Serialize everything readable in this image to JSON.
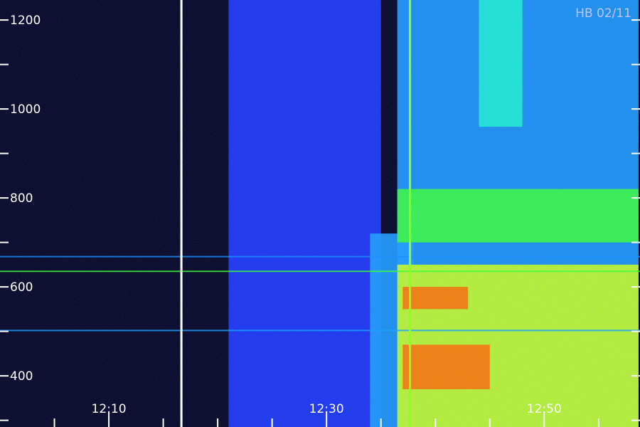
{
  "chart_data": {
    "type": "heatmap",
    "title": "",
    "corner_label": "HB 02/11",
    "xlabel": "",
    "ylabel": "",
    "x_range_minutes": [
      12.0,
      12.98
    ],
    "y_range": [
      285,
      1245
    ],
    "y_major_ticks": [
      {
        "value": 1200,
        "label": "1200"
      },
      {
        "value": 1000,
        "label": "1000"
      },
      {
        "value": 800,
        "label": "800"
      },
      {
        "value": 600,
        "label": "600"
      },
      {
        "value": 400,
        "label": "400"
      }
    ],
    "y_minor_ticks": [
      300,
      500,
      700,
      900,
      1100
    ],
    "x_major_ticks": [
      {
        "value": "12:10",
        "label": "12:10"
      },
      {
        "value": "12:30",
        "label": "12:30"
      },
      {
        "value": "12:50",
        "label": "12:50"
      }
    ],
    "x_minor_ticks": [
      "12:05",
      "12:15",
      "12:20",
      "12:25",
      "12:35",
      "12:40",
      "12:45",
      "12:55"
    ],
    "colormap": [
      "#05051e",
      "#0a0a6a",
      "#1e3cff",
      "#1ea0ff",
      "#1ef0d0",
      "#3cff3c",
      "#c8ff1e",
      "#ffdc00",
      "#ff7800",
      "#ff2814"
    ],
    "vertical_markers": [
      {
        "time": "12:16:40",
        "color": "#ffffff"
      },
      {
        "time": "12:37:40",
        "color": "#8cff1e"
      }
    ],
    "horizontal_lines": [
      {
        "y": 668,
        "color": "#1e90ff"
      },
      {
        "y": 635,
        "color": "#3cff3c"
      },
      {
        "y": 502,
        "color": "#1ea0ff"
      }
    ],
    "intensity_regions": [
      {
        "t_start": "12:21:00",
        "t_end": "12:35:00",
        "y_start": 285,
        "y_end": 1245,
        "level": 0.18
      },
      {
        "t_start": "12:34:00",
        "t_end": "12:38:00",
        "y_start": 285,
        "y_end": 720,
        "level": 0.35
      },
      {
        "t_start": "12:36:30",
        "t_end": "12:58:40",
        "y_start": 285,
        "y_end": 1245,
        "level": 0.32
      },
      {
        "t_start": "12:36:30",
        "t_end": "12:58:40",
        "y_start": 700,
        "y_end": 820,
        "level": 0.58
      },
      {
        "t_start": "12:36:30",
        "t_end": "12:58:40",
        "y_start": 285,
        "y_end": 650,
        "level": 0.72
      },
      {
        "t_start": "12:37:00",
        "t_end": "12:45:00",
        "y_start": 370,
        "y_end": 470,
        "level": 0.93
      },
      {
        "t_start": "12:37:00",
        "t_end": "12:43:00",
        "y_start": 550,
        "y_end": 600,
        "level": 0.86
      },
      {
        "t_start": "12:44:00",
        "t_end": "12:48:00",
        "y_start": 960,
        "y_end": 1245,
        "level": 0.45
      }
    ]
  }
}
